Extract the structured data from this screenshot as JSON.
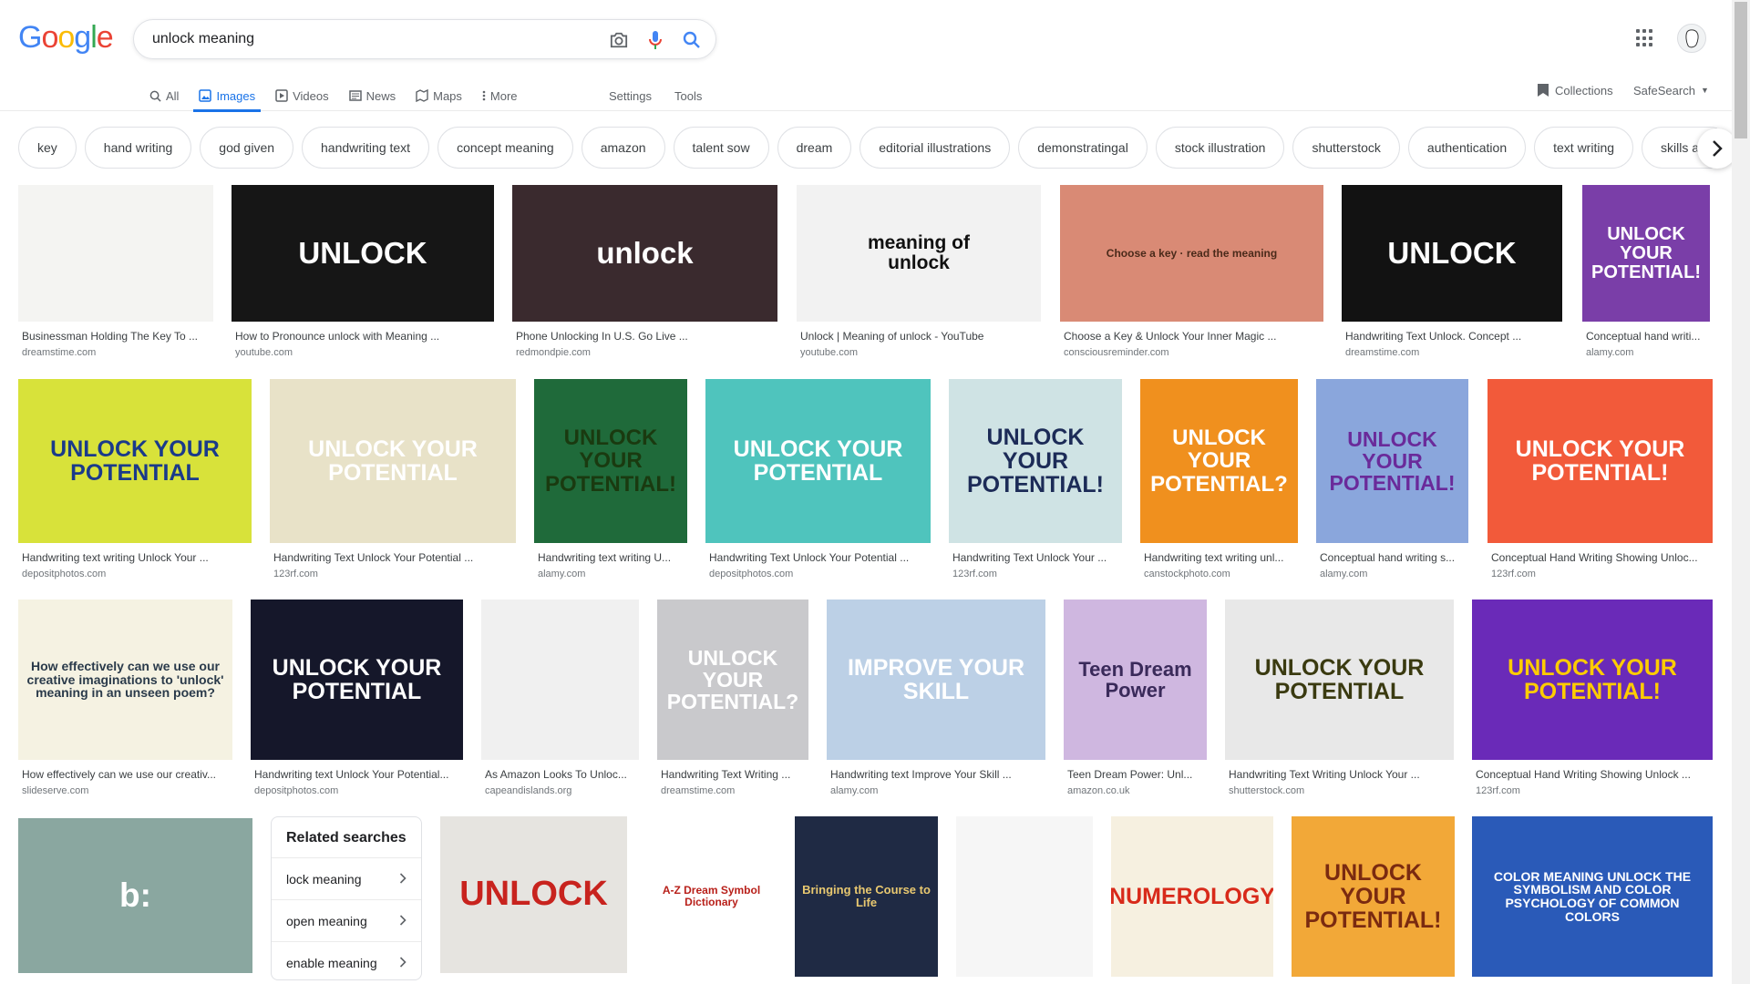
{
  "logo": [
    "G",
    "o",
    "o",
    "g",
    "l",
    "e"
  ],
  "logo_colors": [
    "#4285f4",
    "#ea4335",
    "#fbbc05",
    "#4285f4",
    "#34a853",
    "#ea4335"
  ],
  "search": {
    "query": "unlock meaning"
  },
  "tabs": [
    {
      "label": "All",
      "icon": "search-icon"
    },
    {
      "label": "Images",
      "icon": "image-icon",
      "active": true
    },
    {
      "label": "Videos",
      "icon": "video-icon"
    },
    {
      "label": "News",
      "icon": "news-icon"
    },
    {
      "label": "Maps",
      "icon": "map-icon"
    },
    {
      "label": "More",
      "icon": "more-vert-icon"
    }
  ],
  "settings_label": "Settings",
  "tools_label": "Tools",
  "collections_label": "Collections",
  "safesearch_label": "SafeSearch",
  "chips": [
    "key",
    "hand writing",
    "god given",
    "handwriting text",
    "concept meaning",
    "amazon",
    "talent sow",
    "dream",
    "editorial illustrations",
    "demonstratingal",
    "stock illustration",
    "shutterstock",
    "authentication",
    "text writing",
    "skills abil"
  ],
  "results": [
    {
      "title": "Businessman Holding The Key To ...",
      "source": "dreamstime.com",
      "thumb_text": "",
      "bg": "#f4f4f2",
      "fg": "#222"
    },
    {
      "title": "How to Pronounce unlock with Meaning ...",
      "source": "youtube.com",
      "thumb_text": "UNLOCK",
      "bg": "#161616",
      "fg": "#ffffff"
    },
    {
      "title": "Phone Unlocking In U.S. Go Live ...",
      "source": "redmondpie.com",
      "thumb_text": "unlock",
      "bg": "#3a2a2e",
      "fg": "#ffffff"
    },
    {
      "title": "Unlock | Meaning of unlock - YouTube",
      "source": "youtube.com",
      "thumb_text": "meaning of\nunlock",
      "bg": "#f2f2f2",
      "fg": "#111111"
    },
    {
      "title": "Choose a Key & Unlock Your Inner Magic ...",
      "source": "consciousreminder.com",
      "thumb_text": "Choose a key · read the meaning",
      "bg": "#d98a75",
      "fg": "#4a2a1a"
    },
    {
      "title": "Handwriting Text Unlock. Concept ...",
      "source": "dreamstime.com",
      "thumb_text": "UNLOCK",
      "bg": "#121212",
      "fg": "#ffffff"
    },
    {
      "title": "Conceptual hand writi...",
      "source": "alamy.com",
      "thumb_text": "UNLOCK YOUR POTENTIAL!",
      "bg": "#7a3ea8",
      "fg": "#ffffff"
    },
    {
      "title": "Handwriting text writing Unlock Your ...",
      "source": "depositphotos.com",
      "thumb_text": "UNLOCK YOUR POTENTIAL",
      "bg": "#d8e23a",
      "fg": "#1a3a8a"
    },
    {
      "title": "Handwriting Text Unlock Your Potential ...",
      "source": "123rf.com",
      "thumb_text": "UNLOCK YOUR POTENTIAL",
      "bg": "#e8e2c8",
      "fg": "#ffffff"
    },
    {
      "title": "Handwriting text writing U...",
      "source": "alamy.com",
      "thumb_text": "UNLOCK YOUR POTENTIAL!",
      "bg": "#1f6a3a",
      "fg": "#1a3a10"
    },
    {
      "title": "Handwriting Text Unlock Your Potential ...",
      "source": "depositphotos.com",
      "thumb_text": "UNLOCK YOUR POTENTIAL",
      "bg": "#4fc4bd",
      "fg": "#ffffff"
    },
    {
      "title": "Handwriting Text Unlock Your ...",
      "source": "123rf.com",
      "thumb_text": "UNLOCK YOUR POTENTIAL!",
      "bg": "#cfe3e4",
      "fg": "#1c2b57"
    },
    {
      "title": "Handwriting text writing unl...",
      "source": "canstockphoto.com",
      "thumb_text": "UNLOCK YOUR POTENTIAL?",
      "bg": "#f0901e",
      "fg": "#ffffff"
    },
    {
      "title": "Conceptual hand writing s...",
      "source": "alamy.com",
      "thumb_text": "UNLOCK YOUR POTENTIAL!",
      "bg": "#8aa6dc",
      "fg": "#6a2a9a"
    },
    {
      "title": "Conceptual Hand Writing Showing Unloc...",
      "source": "123rf.com",
      "thumb_text": "UNLOCK YOUR POTENTIAL!",
      "bg": "#f25a3a",
      "fg": "#ffffff"
    },
    {
      "title": "How effectively can we use our creativ...",
      "source": "slideserve.com",
      "thumb_text": "How effectively can we use our creative imaginations to 'unlock' meaning in an unseen poem?",
      "bg": "#f5f2e2",
      "fg": "#2a3a4a"
    },
    {
      "title": "Handwriting text Unlock Your Potential...",
      "source": "depositphotos.com",
      "thumb_text": "UNLOCK YOUR POTENTIAL",
      "bg": "#15172a",
      "fg": "#ffffff"
    },
    {
      "title": "As Amazon Looks To Unloc...",
      "source": "capeandislands.org",
      "thumb_text": "",
      "bg": "#f0f0f0",
      "fg": "#333"
    },
    {
      "title": "Handwriting Text Writing ...",
      "source": "dreamstime.com",
      "thumb_text": "UNLOCK YOUR POTENTIAL?",
      "bg": "#c9c9cc",
      "fg": "#ffffff"
    },
    {
      "title": "Handwriting text Improve Your Skill ...",
      "source": "alamy.com",
      "thumb_text": "IMPROVE YOUR SKILL",
      "bg": "#bcd0e6",
      "fg": "#ffffff"
    },
    {
      "title": "Teen Dream Power: Unl...",
      "source": "amazon.co.uk",
      "thumb_text": "Teen Dream Power",
      "bg": "#cfb7e0",
      "fg": "#3a2a5a"
    },
    {
      "title": "Handwriting Text Writing Unlock Your ...",
      "source": "shutterstock.com",
      "thumb_text": "UNLOCK YOUR POTENTIAL",
      "bg": "#e8e8e8",
      "fg": "#3a3a10"
    },
    {
      "title": "Conceptual Hand Writing Showing Unlock ...",
      "source": "123rf.com",
      "thumb_text": "UNLOCK YOUR POTENTIAL!",
      "bg": "#6a2ab8",
      "fg": "#ffcc00"
    },
    {
      "title": "",
      "source": "",
      "thumb_text": "b:",
      "bg": "#8aa7a0",
      "fg": "#ffffff"
    },
    {
      "title": "",
      "source": "",
      "thumb_text": "UNLOCK",
      "bg": "#e6e4e0",
      "fg": "#c8231e"
    },
    {
      "title": "",
      "source": "",
      "thumb_text": "A-Z Dream Symbol Dictionary",
      "bg": "#ffffff",
      "fg": "#b8201a"
    },
    {
      "title": "",
      "source": "",
      "thumb_text": "Bringing the Course to Life",
      "bg": "#1f2a44",
      "fg": "#e8c870"
    },
    {
      "title": "",
      "source": "",
      "thumb_text": "",
      "bg": "#f6f6f6",
      "fg": "#333"
    },
    {
      "title": "",
      "source": "",
      "thumb_text": "NUMEROLOGY",
      "bg": "#f6f0e0",
      "fg": "#d82a1a"
    },
    {
      "title": "",
      "source": "",
      "thumb_text": "UNLOCK YOUR POTENTIAL!",
      "bg": "#f2a838",
      "fg": "#7a2a10"
    },
    {
      "title": "",
      "source": "",
      "thumb_text": "COLOR MEANING UNLOCK THE SYMBOLISM AND COLOR PSYCHOLOGY OF COMMON COLORS",
      "bg": "#2a5ab8",
      "fg": "#ffffff"
    }
  ],
  "related": {
    "heading": "Related searches",
    "items": [
      "lock meaning",
      "open meaning",
      "enable meaning"
    ]
  }
}
